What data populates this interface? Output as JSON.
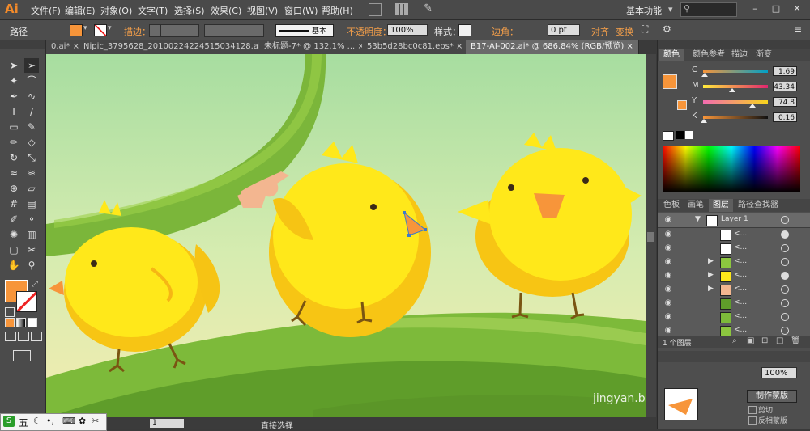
{
  "app": {
    "logo": "Ai"
  },
  "menu": {
    "items": [
      "文件(F)",
      "编辑(E)",
      "对象(O)",
      "文字(T)",
      "选择(S)",
      "效果(C)",
      "视图(V)",
      "窗口(W)",
      "帮助(H)"
    ],
    "workspace": "基本功能",
    "workspace_caret": "▾"
  },
  "control_bar": {
    "selection_label": "路径",
    "stroke_label": "描边：",
    "brush_label": "基本",
    "opacity_label": "不透明度：",
    "opacity_value": "100%",
    "style_label": "样式：",
    "corner_label": "边角：",
    "corner_value": "0 pt",
    "align_label": "对齐",
    "transform_label": "变换",
    "fill_color": "#f7953a"
  },
  "tabs": [
    {
      "label": "0.ai* ×",
      "active": false
    },
    {
      "label": "Nipic_3795628_20100224224515034128.ai* ×",
      "active": false
    },
    {
      "label": "未标题-7* @ 132.1% ... ×",
      "active": false
    },
    {
      "label": "53b5d28bc0c81.eps* ×",
      "active": false
    },
    {
      "label": "B17-AI-002.ai* @ 686.84% (RGB/预览) ×",
      "active": true
    }
  ],
  "toolbar": {
    "tools": [
      "selection-tool",
      "direct-selection-tool",
      "magic-wand-tool",
      "lasso-tool",
      "pen-tool",
      "curvature-tool",
      "type-tool",
      "line-tool",
      "rectangle-tool",
      "paintbrush-tool",
      "pencil-tool",
      "eraser-tool",
      "rotate-tool",
      "scale-tool",
      "width-tool",
      "warp-tool",
      "shape-builder-tool",
      "perspective-tool",
      "mesh-tool",
      "gradient-tool",
      "eyedropper-tool",
      "blend-tool",
      "symbol-sprayer-tool",
      "graph-tool",
      "artboard-tool",
      "slice-tool",
      "hand-tool",
      "zoom-tool"
    ],
    "fill_color": "#f7953a"
  },
  "color_panel": {
    "tabs": [
      "颜色",
      "颜色参考",
      "描边",
      "渐变"
    ],
    "active_tab": "颜色",
    "channels": [
      {
        "name": "C",
        "value": "1.69",
        "fraction": 0.017,
        "gradient": "linear-gradient(90deg,#f7953a,#00a0c6)"
      },
      {
        "name": "M",
        "value": "43.34",
        "fraction": 0.433,
        "gradient": "linear-gradient(90deg,#ffeb3b,#e0266f)"
      },
      {
        "name": "Y",
        "value": "74.8",
        "fraction": 0.748,
        "gradient": "linear-gradient(90deg,#f26bb0,#f7d41d)"
      },
      {
        "name": "K",
        "value": "0.16",
        "fraction": 0.002,
        "gradient": "linear-gradient(90deg,#f7953a,#111)"
      }
    ]
  },
  "layers_panel": {
    "tabs": [
      "色板",
      "画笔",
      "图层",
      "路径查找器"
    ],
    "active_tab": "图层",
    "top_layer": "Layer 1",
    "rows": [
      "<...",
      "<...",
      "<...",
      "<...",
      "<...",
      "<...",
      "<...",
      "<..."
    ],
    "footer": "1 个图层"
  },
  "lower_panel": {
    "make_mask_button": "制作蒙版",
    "clip_label": "剪切",
    "invert_label": "反相蒙版",
    "opacity_value": "100%"
  },
  "status": {
    "zoom_page": "1",
    "tool_name": "直接选择"
  },
  "taskbar": {
    "ime_label": "五"
  },
  "watermark": "jingyan.baidu"
}
